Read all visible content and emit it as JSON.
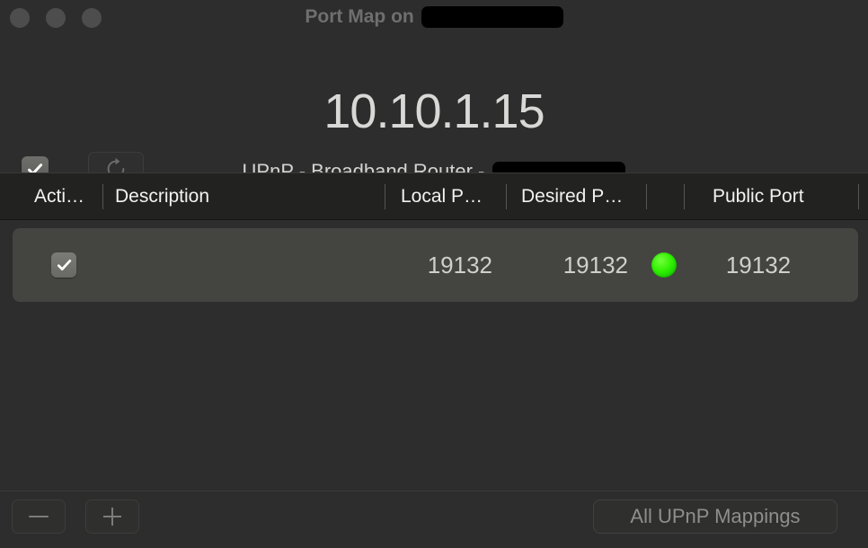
{
  "window": {
    "title_prefix": "Port Map on ",
    "title_redacted": true,
    "traffic_lights": [
      "close-button",
      "minimize-button",
      "zoom-button"
    ]
  },
  "header": {
    "ip_address": "10.10.1.15",
    "subtitle_prefix": "UPnP - Broadband Router - ",
    "subtitle_redacted": true,
    "enable_checkbox_checked": true,
    "refresh_icon": "refresh-icon"
  },
  "table": {
    "columns": [
      {
        "key": "active",
        "label": "Acti…"
      },
      {
        "key": "description",
        "label": "Description"
      },
      {
        "key": "local_port",
        "label": "Local P…"
      },
      {
        "key": "desired_port",
        "label": "Desired P…"
      },
      {
        "key": "status",
        "label": ""
      },
      {
        "key": "public_port",
        "label": "Public Port"
      }
    ],
    "rows": [
      {
        "active": true,
        "description": "",
        "local_port": "19132",
        "desired_port": "19132",
        "status": "ok",
        "status_color": "#2ef000",
        "public_port": "19132",
        "selected": true
      }
    ]
  },
  "bottom_bar": {
    "remove_label": "−",
    "add_label": "+",
    "all_mappings_label": "All UPnP Mappings"
  },
  "colors": {
    "window_bg": "#2d2d2d",
    "header_bg": "#222220",
    "row_bg": "#444441",
    "text": "#d8d8d6",
    "muted_text": "#8e8e8c",
    "status_green": "#2ef000"
  }
}
